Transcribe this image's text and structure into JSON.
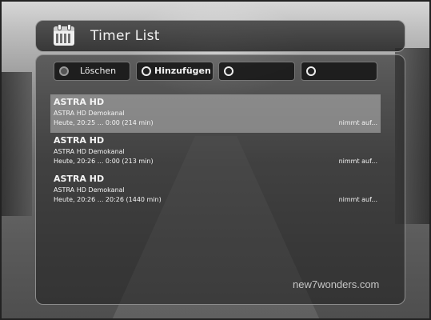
{
  "window": {
    "title": "Timer List"
  },
  "icons": {
    "title_icon": "calendar-icon"
  },
  "buttons": [
    {
      "label": "Löschen",
      "color": "gray"
    },
    {
      "label": "Hinzufügen",
      "color": "white"
    },
    {
      "label": "",
      "color": "white"
    },
    {
      "label": "",
      "color": "white"
    }
  ],
  "timers": [
    {
      "channel": "ASTRA HD",
      "description": "ASTRA HD Demokanal",
      "time": "Heute, 20:25 ... 0:00 (214 min)",
      "status": "nimmt auf...",
      "selected": true
    },
    {
      "channel": "ASTRA HD",
      "description": "ASTRA HD Demokanal",
      "time": "Heute, 20:26 ... 0:00 (213 min)",
      "status": "nimmt auf...",
      "selected": false
    },
    {
      "channel": "ASTRA HD",
      "description": "ASTRA HD Demokanal",
      "time": "Heute, 20:26 ... 20:26 (1440 min)",
      "status": "nimmt auf...",
      "selected": false
    }
  ],
  "watermark": "new7wonders.com"
}
